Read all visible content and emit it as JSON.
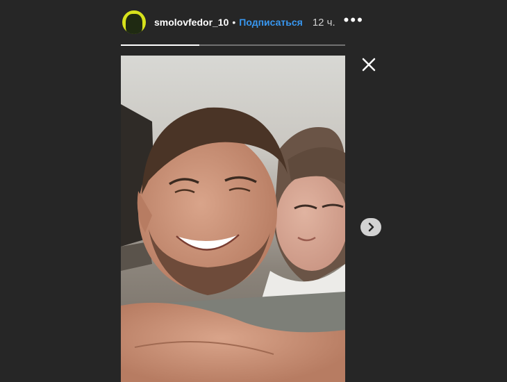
{
  "header": {
    "username": "smolovfedor_10",
    "separator": "•",
    "follow_label": "Подписаться",
    "time": "12 ч.",
    "more": "•••"
  },
  "progress": {
    "value": 0.35
  },
  "icons": {
    "avatar": "profile-avatar-icon",
    "close": "close-icon",
    "next": "chevron-right-icon"
  },
  "colors": {
    "background": "#262626",
    "accent": "#3897f0",
    "avatar_ring": "#d7e21c"
  }
}
